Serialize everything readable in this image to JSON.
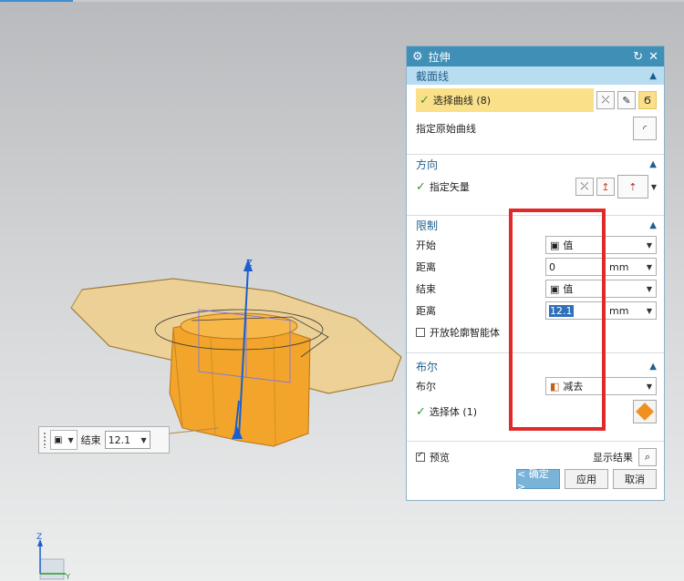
{
  "dialog": {
    "title": "拉伸",
    "sections": {
      "section_curve": {
        "title": "截面线",
        "select_curve": "选择曲线 (8)",
        "specify_origin": "指定原始曲线"
      },
      "direction": {
        "title": "方向",
        "specify_vector": "指定矢量"
      },
      "limits": {
        "title": "限制",
        "start_label": "开始",
        "start_value": "值",
        "distance1_label": "距离",
        "distance1_value": "0",
        "end_label": "结束",
        "end_value": "值",
        "distance2_label": "距离",
        "distance2_value": "12.1",
        "unit": "mm",
        "open_profile": "开放轮廓智能体"
      },
      "boolean": {
        "title": "布尔",
        "bool_label": "布尔",
        "bool_value": "减去",
        "select_body": "选择体 (1)"
      }
    },
    "preview_label": "预览",
    "show_result": "显示结果",
    "ok": "< 确定 >",
    "apply": "应用",
    "cancel": "取消"
  },
  "float_limit": {
    "label": "结束",
    "value": "12.1"
  },
  "axes": {
    "z": "Z",
    "y": "Y"
  },
  "colors": {
    "title_bar": "#3f8fb7",
    "section_active": "#b8dcf0",
    "selection_highlight": "#fbe08a",
    "highlight_box": "#e02a2a",
    "part_orange": "#f2a52a"
  }
}
